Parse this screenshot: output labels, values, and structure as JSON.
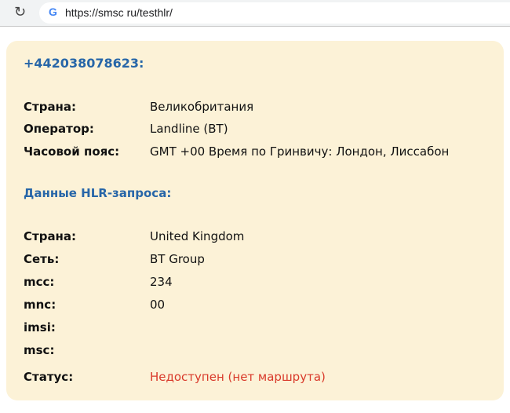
{
  "browser": {
    "url": "https://smsc ru/testhlr/"
  },
  "phone": "+442038078623:",
  "info": [
    {
      "label": "Страна:",
      "value": "Великобритания"
    },
    {
      "label": "Оператор:",
      "value": "Landline (BT)"
    },
    {
      "label": "Часовой пояс:",
      "value": "GMT +00 Время по Гринвичу: Лондон, Лиссабон"
    }
  ],
  "hlr_title": "Данные HLR-запроса:",
  "hlr": [
    {
      "label": "Страна:",
      "value": "United Kingdom"
    },
    {
      "label": "Сеть:",
      "value": "BT Group"
    },
    {
      "label": "mcc:",
      "value": "234"
    },
    {
      "label": "mnc:",
      "value": "00"
    },
    {
      "label": "imsi:",
      "value": ""
    },
    {
      "label": "msc:",
      "value": ""
    },
    {
      "label": "Статус:",
      "value": "Недоступен (нет маршрута)"
    }
  ]
}
